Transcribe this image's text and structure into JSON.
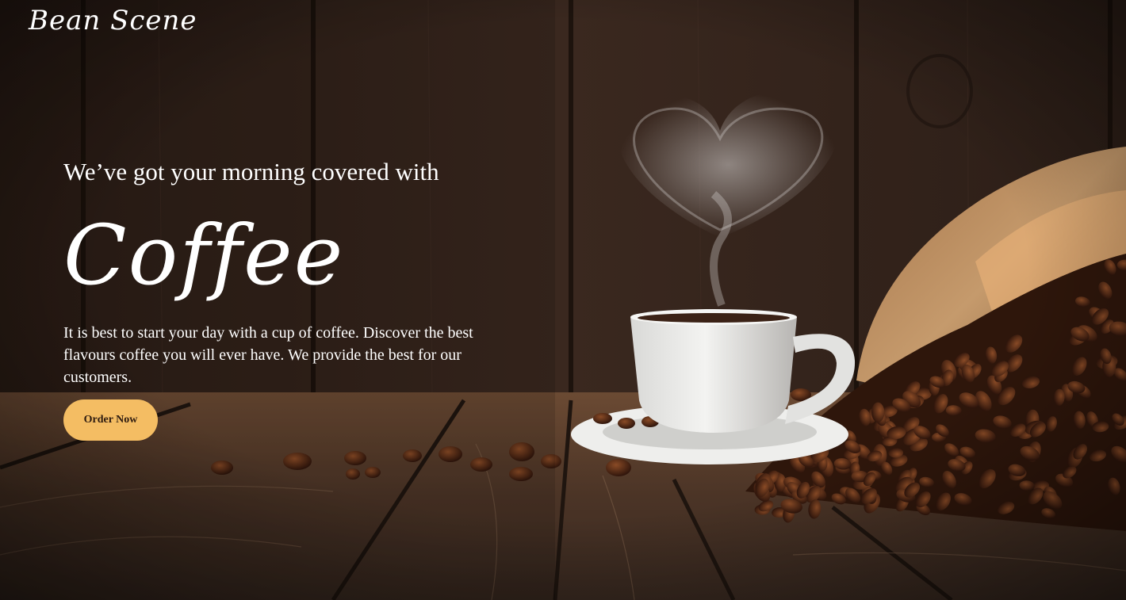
{
  "brand": {
    "name": "Bean Scene"
  },
  "hero": {
    "tagline": "We’ve got your morning covered with",
    "heading": "Coffee",
    "description": "It is best to start your day with a cup of coffee. Discover the best flavours coffee you will ever have. We provide the best for our customers.",
    "cta_label": "Order Now"
  },
  "colors": {
    "accent": "#f4bd63",
    "text": "#ffffff",
    "button_text": "#2d1b10"
  },
  "icons": [
    "coffee-cup-icon",
    "steam-heart-icon",
    "coffee-beans-icon"
  ]
}
